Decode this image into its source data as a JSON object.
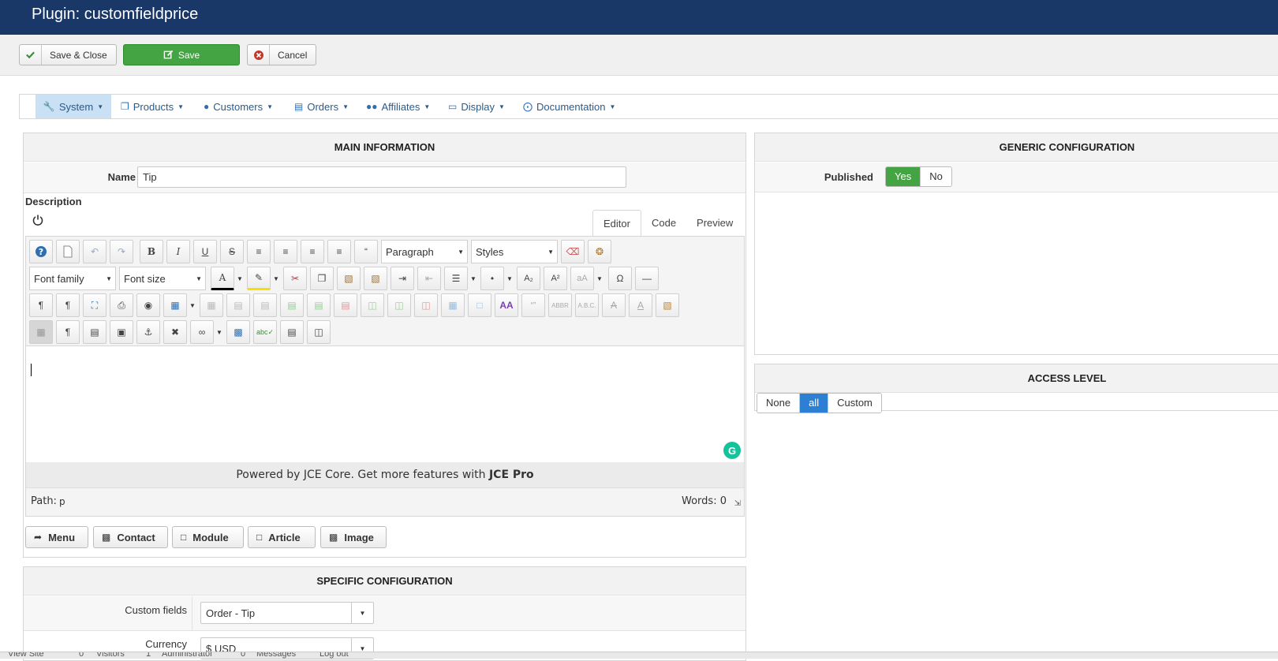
{
  "header": {
    "title": "Plugin: customfieldprice"
  },
  "toolbar": {
    "save_close": "Save & Close",
    "save": "Save",
    "cancel": "Cancel"
  },
  "nav": [
    "System",
    "Products",
    "Customers",
    "Orders",
    "Affiliates",
    "Display",
    "Documentation"
  ],
  "main_info": {
    "heading": "MAIN INFORMATION",
    "name_label": "Name",
    "name_value": "Tip",
    "description_label": "Description",
    "tabs": [
      "Editor",
      "Code",
      "Preview"
    ],
    "format_select": "Paragraph",
    "styles_select": "Styles",
    "font_family": "Font family",
    "font_size": "Font size",
    "powered_prefix": "Powered by JCE Core. Get more features with ",
    "powered_bold": "JCE Pro",
    "path_label": "Path:",
    "path_value": "p",
    "words": "Words: 0",
    "buttons": [
      "Menu",
      "Contact",
      "Module",
      "Article",
      "Image"
    ]
  },
  "generic": {
    "heading": "GENERIC CONFIGURATION",
    "published_label": "Published",
    "yes": "Yes",
    "no": "No"
  },
  "access": {
    "heading": "ACCESS LEVEL",
    "options": [
      "None",
      "all",
      "Custom"
    ]
  },
  "specific": {
    "heading": "SPECIFIC CONFIGURATION",
    "custom_fields_label": "Custom fields",
    "custom_fields_value": "Order - Tip",
    "currency_label": "Currency",
    "currency_value": "$ USD"
  },
  "footer": {
    "links": [
      "View Site",
      "Visitors",
      "Administrator",
      "Messages",
      "Log out"
    ],
    "badges": [
      "0",
      "1",
      "0"
    ]
  },
  "colors": {
    "header": "#1a3867",
    "save_green": "#44a342",
    "selected_blue": "#2d7fd3",
    "nav_active": "#c9e0f5"
  }
}
